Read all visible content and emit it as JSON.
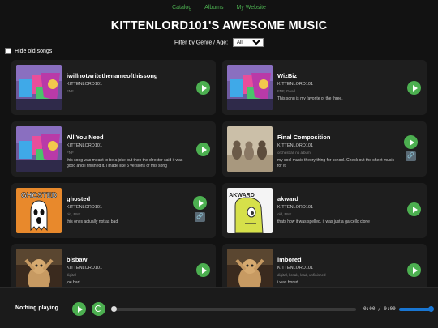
{
  "nav": {
    "links": [
      "Catalog",
      "Albums",
      "My Website"
    ]
  },
  "title": "KITTENLORD101'S AWESOME MUSIC",
  "filter": {
    "label": "Filter by Genre / Age:",
    "value": "All"
  },
  "hide_old": {
    "label": "Hide old songs",
    "checked": false
  },
  "songs": [
    {
      "name": "iwillnotwritethenameofthissong",
      "artist": "KITTENLORD101",
      "tags": "FNF",
      "desc": "",
      "has_link": false
    },
    {
      "name": "WizBiz",
      "artist": "KITTENLORD101",
      "tags": "FNF, Good",
      "desc": "This song is my favorite of the three.",
      "has_link": false
    },
    {
      "name": "All You Need",
      "artist": "KITTENLORD101",
      "tags": "FNF",
      "desc": "this song was meant to be a joke but then the director said it was good and I finished it. i made like 5 versions of this song",
      "has_link": false
    },
    {
      "name": "Final Composition",
      "artist": "KITTENLORD101",
      "tags": "orchestral, no album",
      "desc": "my cool music theory thing for school. Check out the sheet music for it.",
      "has_link": true
    },
    {
      "name": "ghosted",
      "artist": "KITTENLORD101",
      "tags": "old, FNF",
      "desc": "this ones actually not as bad",
      "has_link": true
    },
    {
      "name": "akward",
      "artist": "KITTENLORD101",
      "tags": "old, FNF",
      "desc": "thats how it was spelled. it was just a garcello clone",
      "has_link": false
    },
    {
      "name": "bisbaw",
      "artist": "KITTENLORD101",
      "tags": "digital",
      "desc": "joe bart",
      "has_link": false
    },
    {
      "name": "imbored",
      "artist": "KITTENLORD101",
      "tags": "digital, break, lead, unfinished",
      "desc": "i was bored",
      "has_link": false
    }
  ],
  "thumb_text": {
    "ghosted": "GHOSTED",
    "akward": "AKWARD"
  },
  "player": {
    "now_playing": "Nothing playing",
    "time": "0:00 / 0:00",
    "progress": 0,
    "volume": 1.0
  },
  "colors": {
    "accent": "#4caf50",
    "background": "#121212",
    "card": "#1e1e1e",
    "volume": "#1976d2"
  }
}
